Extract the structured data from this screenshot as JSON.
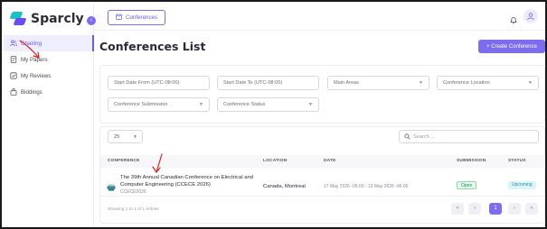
{
  "app": {
    "name": "Sparcly"
  },
  "sidebar": {
    "items": [
      {
        "label": "Chairing",
        "icon": "users-icon",
        "active": true
      },
      {
        "label": "My Papers",
        "icon": "document-icon",
        "active": false
      },
      {
        "label": "My Reviews",
        "icon": "review-icon",
        "active": false
      },
      {
        "label": "Biddings",
        "icon": "bag-icon",
        "active": false
      }
    ]
  },
  "topbar": {
    "tab_label": "Conferences"
  },
  "page": {
    "title": "Conferences List",
    "create_button": "+ Create Conference"
  },
  "filters": {
    "start_from": "Start Date From (UTC-08:00)",
    "start_to": "Start Date To (UTC-08:00)",
    "main_areas": "Main Areas",
    "conference_location": "Conference Location",
    "conference_submission": "Conference Submission",
    "conference_status": "Conference Status"
  },
  "table": {
    "page_size": "25",
    "search_placeholder": "Search ...",
    "headers": {
      "conference": "CONFERENCE",
      "location": "LOCATION",
      "date": "DATE",
      "submission": "SUBMISSION",
      "status": "STATUS"
    },
    "rows": [
      {
        "name": "The 39th Annual Canadian Conference on Electrical and Computer Engineering (CCECE 2026)",
        "code": "CCECE2026",
        "location": "Canada, Montreal",
        "date": "17 May 2026 -06:00 - 19 May 2026 -06:00",
        "submission": "Open",
        "status": "Upcoming"
      }
    ],
    "showing": "Showing 1 to 1 of 1 entries",
    "pagination": {
      "first": "«",
      "prev": "‹",
      "current": "1",
      "next": "›",
      "last": "»"
    }
  },
  "colors": {
    "accent": "#7b6cf0",
    "annotation": "#e02020"
  }
}
